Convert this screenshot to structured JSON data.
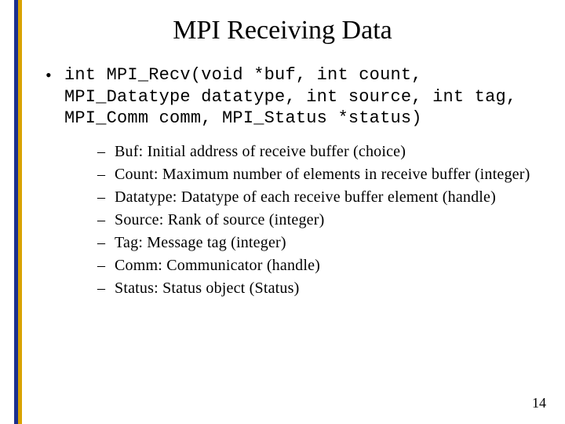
{
  "title": "MPI Receiving Data",
  "signature": "int MPI_Recv(void *buf, int count, MPI_Datatype datatype, int source, int tag, MPI_Comm comm, MPI_Status *status)",
  "params": [
    {
      "name": "Buf",
      "desc": "Initial address of receive buffer (choice)"
    },
    {
      "name": "Count",
      "desc": "Maximum number of elements in receive buffer (integer)"
    },
    {
      "name": "Datatype",
      "desc": "Datatype of each receive buffer element (handle)"
    },
    {
      "name": "Source",
      "desc": "Rank of source (integer)"
    },
    {
      "name": "Tag",
      "desc": "Message tag (integer)"
    },
    {
      "name": "Comm",
      "desc": "Communicator (handle)"
    },
    {
      "name": "Status",
      "desc": "Status object (Status)"
    }
  ],
  "page_number": "14",
  "colors": {
    "stripe_blue": "#1a2f8f",
    "stripe_gold": "#d9a300"
  }
}
